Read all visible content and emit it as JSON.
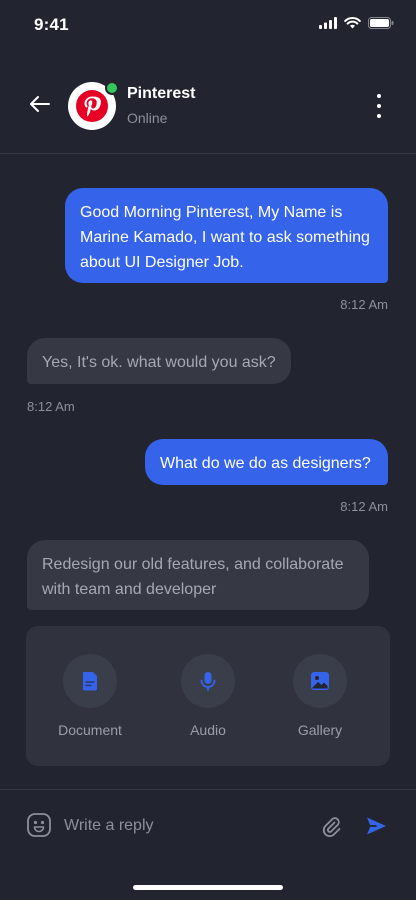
{
  "status_bar": {
    "time": "9:41",
    "icons": [
      "signal-icon",
      "wifi-icon",
      "battery-icon"
    ]
  },
  "header": {
    "contact_name": "Pinterest",
    "contact_status": "Online",
    "icons": [
      "back-arrow-icon",
      "pinterest-logo",
      "more-vertical-icon"
    ]
  },
  "messages": [
    {
      "direction": "out",
      "text": "Good Morning Pinterest, My Name is Marine Kamado, I want to ask something about UI Designer Job.",
      "time": "8:12 Am"
    },
    {
      "direction": "in",
      "text": "Yes, It's ok. what would you ask?",
      "time": "8:12 Am"
    },
    {
      "direction": "out",
      "text": "What do we do as designers?",
      "time": "8:12 Am"
    },
    {
      "direction": "in",
      "text": "Redesign our old features, and collaborate with team and developer",
      "time": ""
    }
  ],
  "attachments": [
    {
      "label": "Document",
      "icon": "document-icon"
    },
    {
      "label": "Audio",
      "icon": "microphone-icon"
    },
    {
      "label": "Gallery",
      "icon": "gallery-icon"
    }
  ],
  "input_bar": {
    "placeholder": "Write a reply",
    "value": "",
    "icons": [
      "emoji-icon",
      "paperclip-icon",
      "send-icon"
    ]
  },
  "colors": {
    "background": "#22252f",
    "accent": "#3563e9",
    "incoming_bubble": "#363944",
    "online": "#34c759",
    "pinterest_red": "#e60023"
  }
}
